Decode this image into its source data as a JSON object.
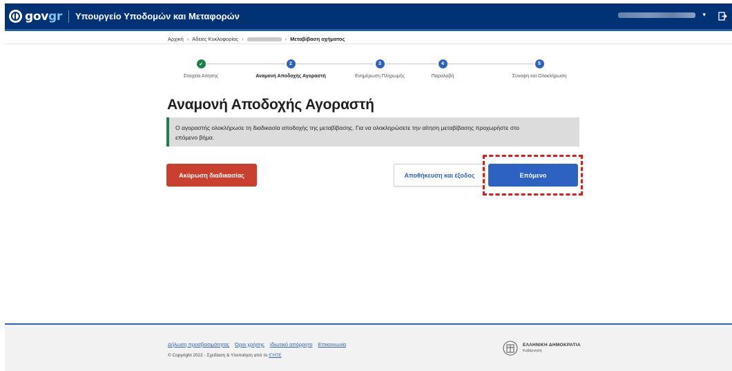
{
  "header": {
    "logo_prefix": "gov",
    "logo_suffix": "gr",
    "ministry": "Υπουργείο Υποδομών και Μεταφορών",
    "user_caret": "▾"
  },
  "breadcrumb": {
    "items": [
      "Αρχική",
      "Άδειες Κυκλοφορίας",
      "Μεταβίβαση οχήματος"
    ],
    "separator": "›"
  },
  "stepper": {
    "steps": [
      {
        "number": "✓",
        "label": "Στοιχεία Αίτησης",
        "state": "done"
      },
      {
        "number": "2",
        "label": "Αναμονή Αποδοχής Αγοραστή",
        "state": "active"
      },
      {
        "number": "3",
        "label": "Ενημέρωση Πληρωμής",
        "state": "todo"
      },
      {
        "number": "4",
        "label": "Παραλαβή",
        "state": "todo"
      },
      {
        "number": "5",
        "label": "Σύνοψη και Ολοκλήρωση",
        "state": "todo"
      }
    ]
  },
  "main": {
    "title": "Αναμονή Αποδοχής Αγοραστή",
    "notice_line1": "Ο αγοραστής ολοκλήρωσε τη διαδικασία αποδοχής της μεταβίβασης. Για να ολοκληρώσετε την αίτηση μεταβίβασης προχωρήστε στο",
    "notice_line2": "επόμενο βήμα."
  },
  "buttons": {
    "cancel": "Ακύρωση διαδικασίας",
    "save_exit": "Αποθήκευση και έξοδος",
    "next": "Επόμενο"
  },
  "footer": {
    "links": [
      "Δήλωση προσβασιμότητας",
      "Όροι χρήσης",
      "Ιδιωτικό απόρρητο",
      "Επικοινωνία"
    ],
    "copyright_prefix": "© Copyright 2022 - Σχεδίαση & Υλοποίηση από το",
    "copyright_link": "ΙΓΗΤΕ",
    "gov_title": "ΕΛΛΗΝΙΚΗ ΔΗΜΟΚΡΑΤΙΑ",
    "gov_subtitle": "Κυβέρνηση"
  },
  "colors": {
    "header_bg": "#003375",
    "primary": "#2d62c3",
    "danger": "#c9412e",
    "success": "#1a7f4b",
    "highlight": "#e11a1a"
  },
  "icons": [
    "gov-emblem-icon",
    "check-icon",
    "logout-icon",
    "caret-down-icon",
    "hellenic-republic-emblem-icon"
  ]
}
